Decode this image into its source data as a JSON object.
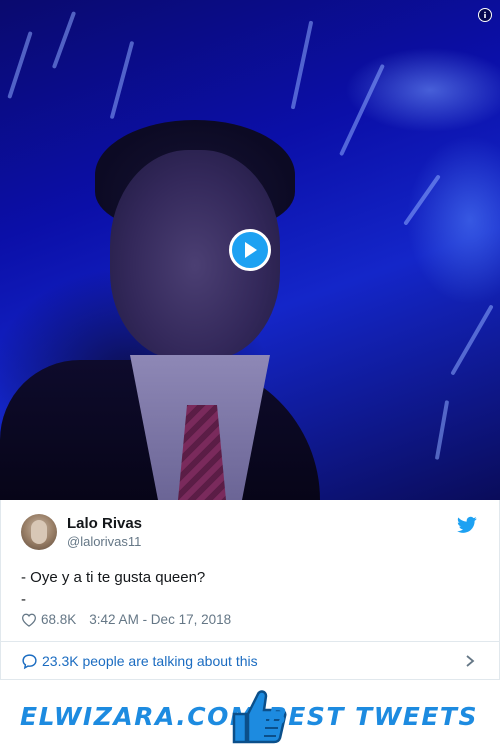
{
  "media": {
    "video_state": "paused",
    "play_icon": "play-icon",
    "info_icon": "info-icon",
    "accent": "#1da1f2"
  },
  "tweet": {
    "author_name": "Lalo Rivas",
    "author_handle": "@lalorivas11",
    "text_line1": "- Oye y a ti te gusta queen?",
    "text_line2": "-",
    "likes": "68.8K",
    "timestamp": "3:42 AM - Dec 17, 2018",
    "conversation": "23.3K people are talking about this",
    "link_color": "#1b6cc1",
    "brand_icon": "twitter-bird-icon"
  },
  "footer": {
    "left": "ELWIZARA.COM",
    "right": "BEST TWEETS",
    "icon": "thumbs-up-icon",
    "color": "#1d8be0"
  }
}
